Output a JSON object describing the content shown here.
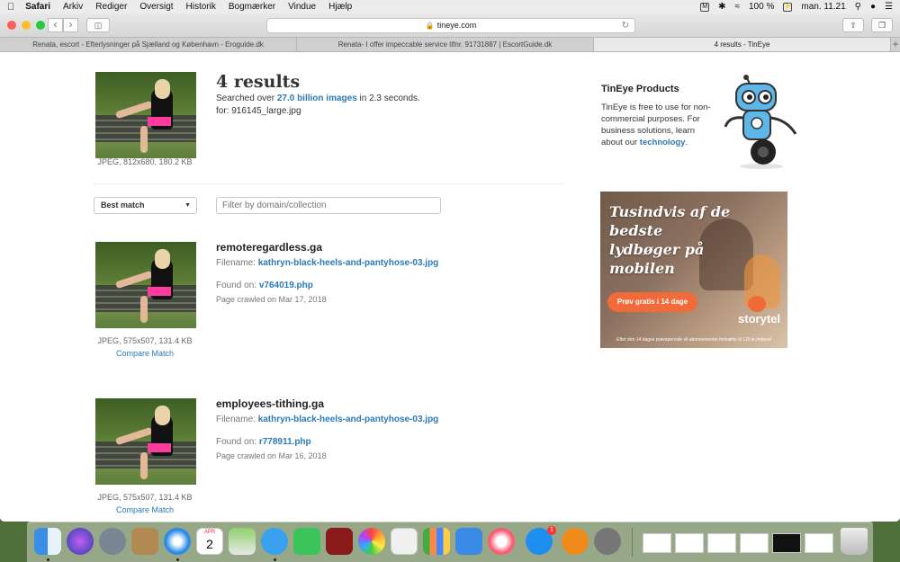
{
  "menubar": {
    "app": "Safari",
    "items": [
      "Arkiv",
      "Rediger",
      "Oversigt",
      "Historik",
      "Bogmærker",
      "Vindue",
      "Hjælp"
    ],
    "battery": "100 %",
    "clock": "man. 11.21"
  },
  "browser": {
    "url": "tineye.com",
    "tabs": [
      "Renata, escort - Efterlysninger på Sjælland og København - Eroguide.dk",
      "Renata- I offer impeccable service tlfnr. 91731887 | EscortGuide.dk",
      "4 results - TinEye"
    ]
  },
  "query": {
    "count": "4 results",
    "searched_prefix": "Searched over ",
    "searched_link": "27.0 billion images",
    "searched_suffix": " in 2.3 seconds.",
    "for_line": "for: 916145_large.jpg",
    "image_info": "JPEG, 812x680, 180.2 KB"
  },
  "controls": {
    "sort_selected": "Best match",
    "filter_placeholder": "Filter by domain/collection"
  },
  "results": [
    {
      "domain": "remoteregardless.ga",
      "filename_label": "Filename:",
      "filename": "kathryn-black-heels-and-pantyhose-03.jpg",
      "found_label": "Found on:",
      "found_on": "v764019.php",
      "crawled": "Page crawled on Mar 17, 2018",
      "image_info": "JPEG, 575x507, 131.4 KB",
      "compare": "Compare Match"
    },
    {
      "domain": "employees-tithing.ga",
      "filename_label": "Filename:",
      "filename": "kathryn-black-heels-and-pantyhose-03.jpg",
      "found_label": "Found on:",
      "found_on": "r778911.php",
      "crawled": "Page crawled on Mar 16, 2018",
      "image_info": "JPEG, 575x507, 131.4 KB",
      "compare": "Compare Match"
    }
  ],
  "sidebar": {
    "title": "TinEye Products",
    "body_prefix": "TinEye is free to use for non-commercial purposes. For business solutions, learn about our ",
    "body_link": "technology",
    "body_suffix": "."
  },
  "ad": {
    "headline": "Tusindvis af de bedste lydbøger på mobilen",
    "cta": "Prøv gratis i 14 dage",
    "brand": "storytel",
    "fine_print": "Efter den 14 dages prøveperiode vil abonnementet fortsætte til 129 kr./måned"
  },
  "dock": {
    "calendar_month": "APR",
    "calendar_day": "2",
    "appstore_badge": "1"
  },
  "colors": {
    "link": "#2a7ab9",
    "pink": "#ff3c9e",
    "ad_cta": "#f06a3a"
  }
}
